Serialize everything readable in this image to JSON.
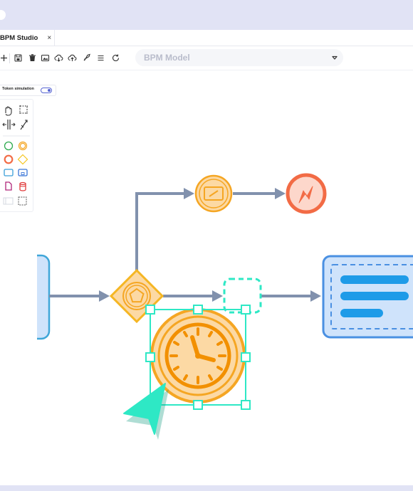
{
  "tab": {
    "title": "BPM Studio",
    "close": "×"
  },
  "toolbar": {
    "icons": [
      "add-icon",
      "save-icon",
      "trash-icon",
      "image-icon",
      "cloud-download-icon",
      "cloud-upload-icon",
      "rocket-icon",
      "list-icon",
      "refresh-icon"
    ]
  },
  "model_select": {
    "value": "BPM Model",
    "icon": "chevron-down-icon"
  },
  "token_simulation": {
    "label": "Token simulation",
    "enabled": true
  },
  "palette": {
    "tools": [
      "hand-tool-icon",
      "lasso-tool-icon",
      "space-tool-icon",
      "connect-tool-icon"
    ],
    "elements": [
      "start-event-icon",
      "intermediate-event-icon",
      "end-event-icon",
      "gateway-icon",
      "task-icon",
      "subprocess-icon",
      "data-object-icon",
      "data-store-icon",
      "pool-icon",
      "group-icon"
    ]
  },
  "diagram": {
    "nodes": [
      "start-event-partial",
      "exclusive-gateway",
      "message-event",
      "error-end-event",
      "placeholder-task",
      "timer-event",
      "task-card"
    ],
    "selected": "timer-event"
  },
  "colors": {
    "accent": "#5664d2",
    "flow": "#8191ad",
    "orange": "#f5a623",
    "orange_fill": "#fcd9a4",
    "red": "#f26b45",
    "teal": "#2ee8c5",
    "blue": "#4a90e2",
    "blue_fill": "#cfe3fb",
    "chrome": "#e1e3f5"
  }
}
